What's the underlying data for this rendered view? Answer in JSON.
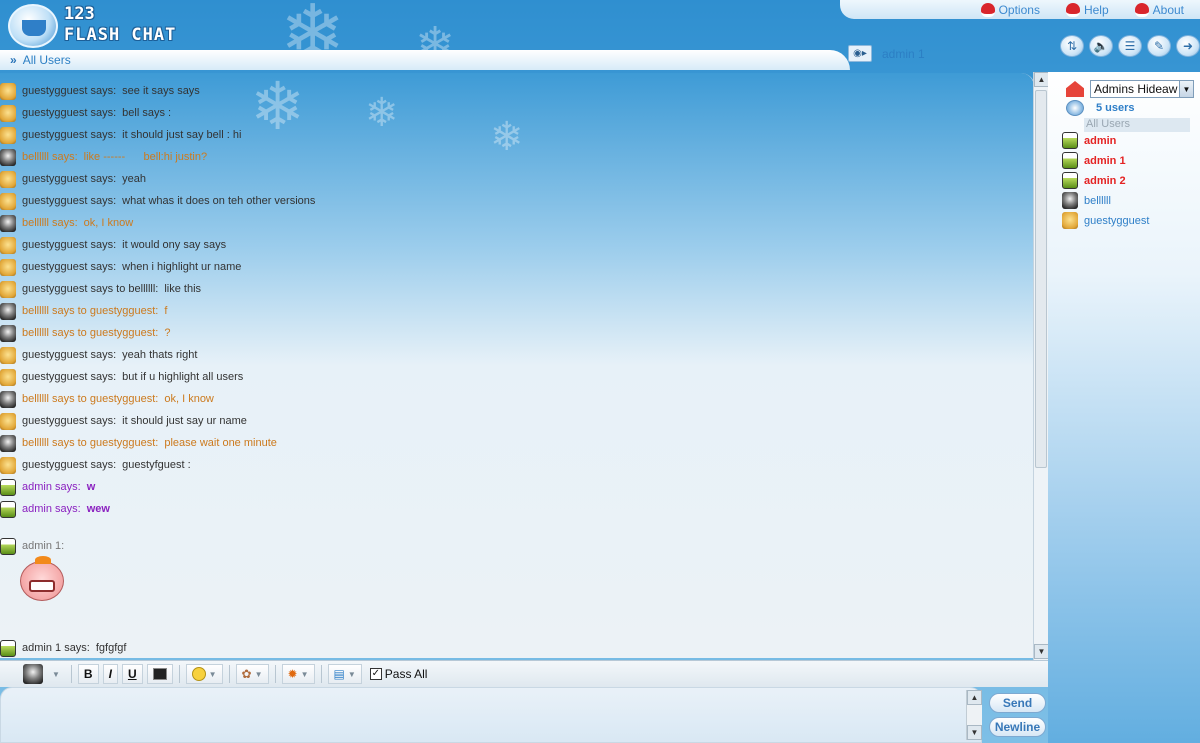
{
  "app": {
    "logo_number": "123",
    "logo_name": "FLASH CHAT"
  },
  "top_menu": [
    {
      "label": "Options",
      "icon": "santa-hat-icon"
    },
    {
      "label": "Help",
      "icon": "santa-hat-icon"
    },
    {
      "label": "About",
      "icon": "santa-hat-icon"
    }
  ],
  "tab": {
    "label": "All Users"
  },
  "current_user": {
    "name": "admin 1"
  },
  "tools": [
    "sort-icon",
    "volume-icon",
    "notes-icon",
    "edit-icon",
    "logout-icon"
  ],
  "messages": [
    {
      "sender": "guestygguest says:",
      "text": "see it says says",
      "type": "guest"
    },
    {
      "sender": "guestygguest says:",
      "text": "bell says :",
      "type": "guest"
    },
    {
      "sender": "guestygguest says:",
      "text": "it should just say bell : hi",
      "type": "guest"
    },
    {
      "sender": "bellllll says:",
      "text": "like ------      bell:hi justin?",
      "type": "bell"
    },
    {
      "sender": "guestygguest says:",
      "text": "yeah",
      "type": "guest"
    },
    {
      "sender": "guestygguest says:",
      "text": "what whas it does on teh other versions",
      "type": "guest"
    },
    {
      "sender": "bellllll says:",
      "text": "ok, I know",
      "type": "bell"
    },
    {
      "sender": "guestygguest says:",
      "text": "it would ony say says",
      "type": "guest"
    },
    {
      "sender": "guestygguest says:",
      "text": "when i highlight ur name",
      "type": "guest"
    },
    {
      "sender": "guestygguest says to bellllll:",
      "text": "like this",
      "type": "guest"
    },
    {
      "sender": "bellllll says to guestygguest:",
      "text": "f",
      "type": "bell"
    },
    {
      "sender": "bellllll says to guestygguest:",
      "text": "?",
      "type": "bell"
    },
    {
      "sender": "guestygguest says:",
      "text": "yeah thats right",
      "type": "guest"
    },
    {
      "sender": "guestygguest says:",
      "text": "but if u highlight all users",
      "type": "guest"
    },
    {
      "sender": "bellllll says to guestygguest:",
      "text": "ok, I know",
      "type": "bell"
    },
    {
      "sender": "guestygguest says:",
      "text": "it should just say ur name",
      "type": "guest"
    },
    {
      "sender": "bellllll says to guestygguest:",
      "text": "please wait one minute",
      "type": "bell"
    },
    {
      "sender": "guestygguest says:",
      "text": "guestyfguest :",
      "type": "guest"
    },
    {
      "sender": "admin says:",
      "text": "w",
      "type": "admin"
    },
    {
      "sender": "admin says:",
      "text": "wew",
      "type": "admin"
    }
  ],
  "emote_message": {
    "sender": "admin 1:",
    "emoticon": "grinning-face-emoticon"
  },
  "last_message": {
    "sender": "admin 1 says:",
    "text": "fgfgfgf"
  },
  "room": {
    "selected": "Admins Hideaw",
    "user_count": "5 users",
    "all_users": "All Users"
  },
  "users": [
    {
      "name": "admin",
      "type": "admin"
    },
    {
      "name": "admin 1",
      "type": "admin"
    },
    {
      "name": "admin 2",
      "type": "admin"
    },
    {
      "name": "bellllll",
      "type": "bell"
    },
    {
      "name": "guestygguest",
      "type": "guest"
    }
  ],
  "toolbar": {
    "bold": "B",
    "italic": "I",
    "underline": "U",
    "pass_all": "Pass All",
    "pass_all_checked": true
  },
  "input": {
    "value": ""
  },
  "buttons": {
    "send": "Send",
    "newline": "Newline"
  },
  "colors": {
    "guest_text": "#333333",
    "bell_text": "#cc7a1e",
    "admin_text": "#8b22c0",
    "admin_user": "#e42323",
    "accent": "#2f7fc8"
  }
}
